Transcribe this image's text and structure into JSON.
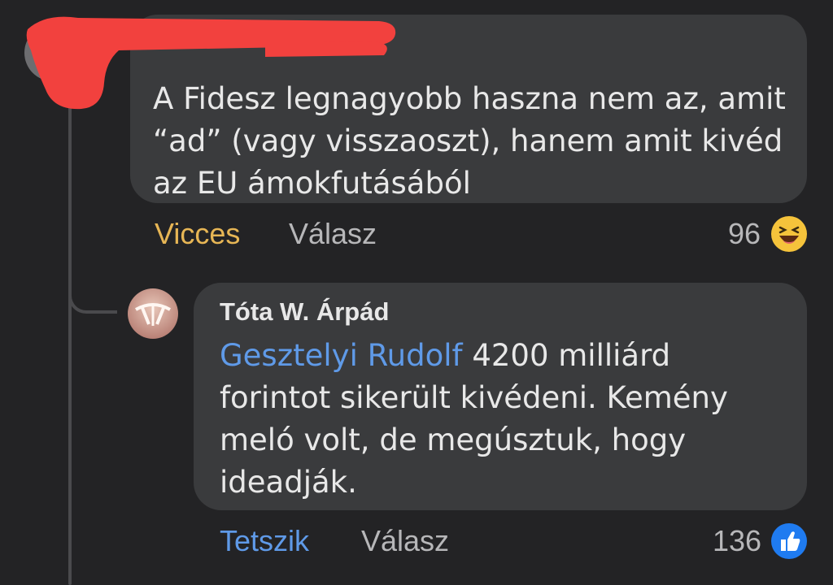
{
  "comment1": {
    "author": "",
    "text": "A Fidesz legnagyobb haszna nem az, amit “ad” (vagy visszaoszt), hanem amit kivéd az EU ámokfutásából",
    "actions": {
      "reaction": "Vicces",
      "reply": "Válasz"
    },
    "reaction_count": "96",
    "reaction_icon": "laughing-emoji-icon"
  },
  "comment2": {
    "author": "Tóta W. Árpád",
    "mention": "Gesztelyi Rudolf",
    "text": " 4200 milliárd forintot sikerült kivédeni. Kemény meló volt, de megúsztuk, hogy ideadják.",
    "actions": {
      "reaction": "Tetszik",
      "reply": "Válasz"
    },
    "reaction_count": "136",
    "reaction_icon": "like-thumb-icon"
  },
  "colors": {
    "background": "#232325",
    "bubble": "#3a3b3d",
    "funny_reaction": "#e7b655",
    "like_reaction": "#5f9ae8",
    "mention": "#5f9ae8",
    "redaction": "#f2413e"
  }
}
